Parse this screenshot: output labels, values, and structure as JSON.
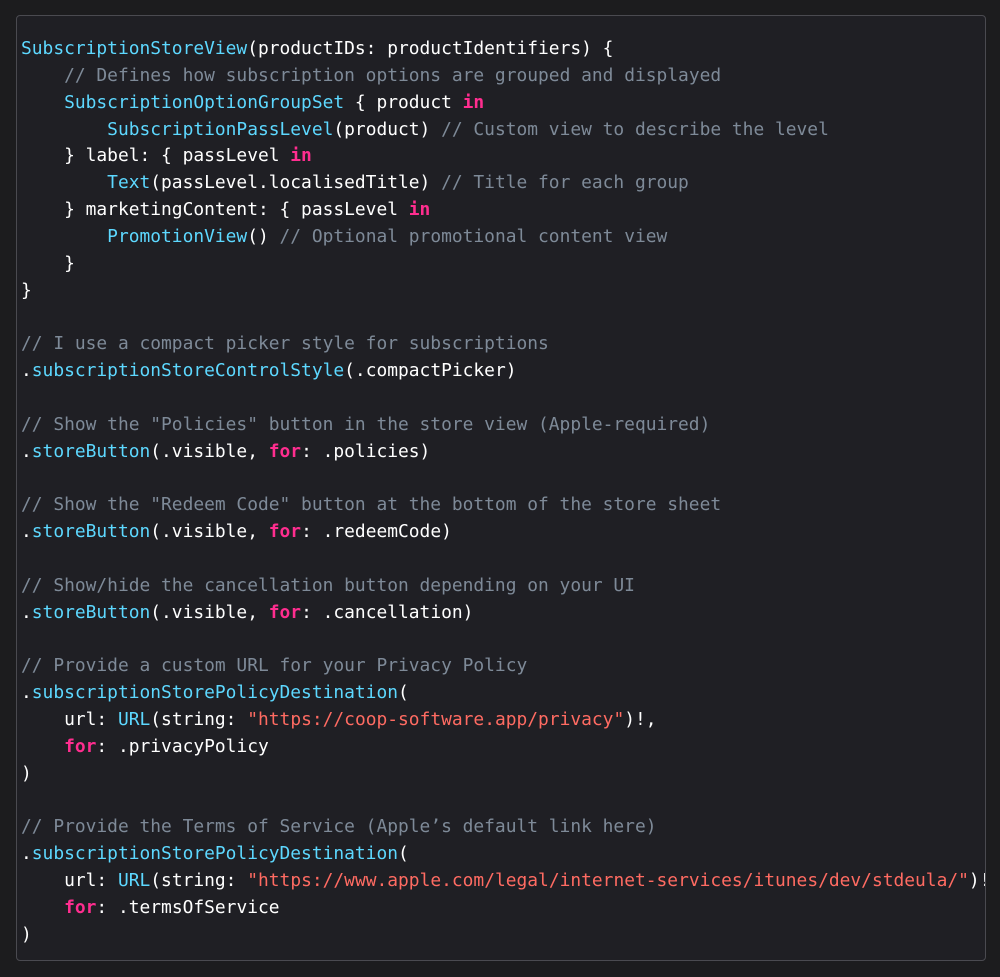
{
  "colors": {
    "background": "#1c1c1e",
    "panel": "#1f1f24",
    "plain": "#ffffff",
    "keyword": "#ff2d8f",
    "type": "#5dd8ff",
    "comment": "#7e8a98",
    "string": "#ff6b62"
  },
  "code_lines": [
    [
      [
        "ty",
        "SubscriptionStoreView"
      ],
      [
        "tx",
        "(productIDs: productIdentifiers) {"
      ]
    ],
    [
      [
        "tx",
        "    "
      ],
      [
        "cm",
        "// Defines how subscription options are grouped and displayed"
      ]
    ],
    [
      [
        "tx",
        "    "
      ],
      [
        "ty",
        "SubscriptionOptionGroupSet"
      ],
      [
        "tx",
        " { product "
      ],
      [
        "kw",
        "in"
      ]
    ],
    [
      [
        "tx",
        "        "
      ],
      [
        "ty",
        "SubscriptionPassLevel"
      ],
      [
        "tx",
        "(product) "
      ],
      [
        "cm",
        "// Custom view to describe the level"
      ]
    ],
    [
      [
        "tx",
        "    } label: { passLevel "
      ],
      [
        "kw",
        "in"
      ]
    ],
    [
      [
        "tx",
        "        "
      ],
      [
        "ty",
        "Text"
      ],
      [
        "tx",
        "(passLevel.localisedTitle) "
      ],
      [
        "cm",
        "// Title for each group"
      ]
    ],
    [
      [
        "tx",
        "    } marketingContent: { passLevel "
      ],
      [
        "kw",
        "in"
      ]
    ],
    [
      [
        "tx",
        "        "
      ],
      [
        "ty",
        "PromotionView"
      ],
      [
        "tx",
        "() "
      ],
      [
        "cm",
        "// Optional promotional content view"
      ]
    ],
    [
      [
        "tx",
        "    }"
      ]
    ],
    [
      [
        "tx",
        "}"
      ]
    ],
    [],
    [
      [
        "cm",
        "// I use a compact picker style for subscriptions"
      ]
    ],
    [
      [
        "tx",
        "."
      ],
      [
        "fn",
        "subscriptionStoreControlStyle"
      ],
      [
        "tx",
        "(.compactPicker)"
      ]
    ],
    [],
    [
      [
        "cm",
        "// Show the \"Policies\" button in the store view (Apple-required)"
      ]
    ],
    [
      [
        "tx",
        "."
      ],
      [
        "fn",
        "storeButton"
      ],
      [
        "tx",
        "(.visible, "
      ],
      [
        "kw",
        "for"
      ],
      [
        "tx",
        ": .policies)"
      ]
    ],
    [],
    [
      [
        "cm",
        "// Show the \"Redeem Code\" button at the bottom of the store sheet"
      ]
    ],
    [
      [
        "tx",
        "."
      ],
      [
        "fn",
        "storeButton"
      ],
      [
        "tx",
        "(.visible, "
      ],
      [
        "kw",
        "for"
      ],
      [
        "tx",
        ": .redeemCode)"
      ]
    ],
    [],
    [
      [
        "cm",
        "// Show/hide the cancellation button depending on your UI"
      ]
    ],
    [
      [
        "tx",
        "."
      ],
      [
        "fn",
        "storeButton"
      ],
      [
        "tx",
        "(.visible, "
      ],
      [
        "kw",
        "for"
      ],
      [
        "tx",
        ": .cancellation)"
      ]
    ],
    [],
    [
      [
        "cm",
        "// Provide a custom URL for your Privacy Policy"
      ]
    ],
    [
      [
        "tx",
        "."
      ],
      [
        "fn",
        "subscriptionStorePolicyDestination"
      ],
      [
        "tx",
        "("
      ]
    ],
    [
      [
        "tx",
        "    url: "
      ],
      [
        "ty",
        "URL"
      ],
      [
        "tx",
        "(string: "
      ],
      [
        "st",
        "\"https://coop-software.app/privacy\""
      ],
      [
        "tx",
        ")!,"
      ]
    ],
    [
      [
        "tx",
        "    "
      ],
      [
        "kw",
        "for"
      ],
      [
        "tx",
        ": .privacyPolicy"
      ]
    ],
    [
      [
        "tx",
        ")"
      ]
    ],
    [],
    [
      [
        "cm",
        "// Provide the Terms of Service (Apple’s default link here)"
      ]
    ],
    [
      [
        "tx",
        "."
      ],
      [
        "fn",
        "subscriptionStorePolicyDestination"
      ],
      [
        "tx",
        "("
      ]
    ],
    [
      [
        "tx",
        "    url: "
      ],
      [
        "ty",
        "URL"
      ],
      [
        "tx",
        "(string: "
      ],
      [
        "st",
        "\"https://www.apple.com/legal/internet-services/itunes/dev/stdeula/\""
      ],
      [
        "tx",
        ")!"
      ]
    ],
    [
      [
        "tx",
        "    "
      ],
      [
        "kw",
        "for"
      ],
      [
        "tx",
        ": .termsOfService"
      ]
    ],
    [
      [
        "tx",
        ")"
      ]
    ]
  ]
}
